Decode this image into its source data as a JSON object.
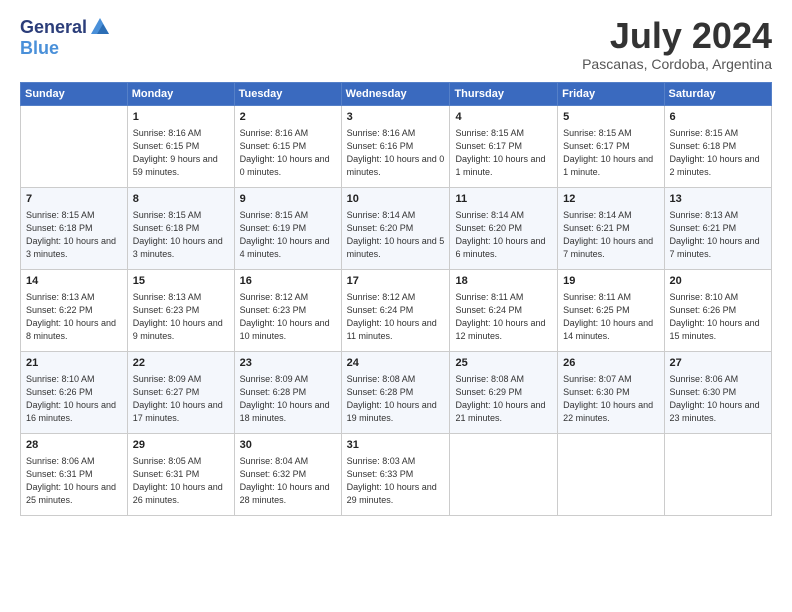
{
  "logo": {
    "general": "General",
    "blue": "Blue"
  },
  "title": "July 2024",
  "location": "Pascanas, Cordoba, Argentina",
  "weekdays": [
    "Sunday",
    "Monday",
    "Tuesday",
    "Wednesday",
    "Thursday",
    "Friday",
    "Saturday"
  ],
  "weeks": [
    [
      {
        "day": "",
        "sunrise": "",
        "sunset": "",
        "daylight": ""
      },
      {
        "day": "1",
        "sunrise": "Sunrise: 8:16 AM",
        "sunset": "Sunset: 6:15 PM",
        "daylight": "Daylight: 9 hours and 59 minutes."
      },
      {
        "day": "2",
        "sunrise": "Sunrise: 8:16 AM",
        "sunset": "Sunset: 6:15 PM",
        "daylight": "Daylight: 10 hours and 0 minutes."
      },
      {
        "day": "3",
        "sunrise": "Sunrise: 8:16 AM",
        "sunset": "Sunset: 6:16 PM",
        "daylight": "Daylight: 10 hours and 0 minutes."
      },
      {
        "day": "4",
        "sunrise": "Sunrise: 8:15 AM",
        "sunset": "Sunset: 6:17 PM",
        "daylight": "Daylight: 10 hours and 1 minute."
      },
      {
        "day": "5",
        "sunrise": "Sunrise: 8:15 AM",
        "sunset": "Sunset: 6:17 PM",
        "daylight": "Daylight: 10 hours and 1 minute."
      },
      {
        "day": "6",
        "sunrise": "Sunrise: 8:15 AM",
        "sunset": "Sunset: 6:18 PM",
        "daylight": "Daylight: 10 hours and 2 minutes."
      }
    ],
    [
      {
        "day": "7",
        "sunrise": "Sunrise: 8:15 AM",
        "sunset": "Sunset: 6:18 PM",
        "daylight": "Daylight: 10 hours and 3 minutes."
      },
      {
        "day": "8",
        "sunrise": "Sunrise: 8:15 AM",
        "sunset": "Sunset: 6:18 PM",
        "daylight": "Daylight: 10 hours and 3 minutes."
      },
      {
        "day": "9",
        "sunrise": "Sunrise: 8:15 AM",
        "sunset": "Sunset: 6:19 PM",
        "daylight": "Daylight: 10 hours and 4 minutes."
      },
      {
        "day": "10",
        "sunrise": "Sunrise: 8:14 AM",
        "sunset": "Sunset: 6:20 PM",
        "daylight": "Daylight: 10 hours and 5 minutes."
      },
      {
        "day": "11",
        "sunrise": "Sunrise: 8:14 AM",
        "sunset": "Sunset: 6:20 PM",
        "daylight": "Daylight: 10 hours and 6 minutes."
      },
      {
        "day": "12",
        "sunrise": "Sunrise: 8:14 AM",
        "sunset": "Sunset: 6:21 PM",
        "daylight": "Daylight: 10 hours and 7 minutes."
      },
      {
        "day": "13",
        "sunrise": "Sunrise: 8:13 AM",
        "sunset": "Sunset: 6:21 PM",
        "daylight": "Daylight: 10 hours and 7 minutes."
      }
    ],
    [
      {
        "day": "14",
        "sunrise": "Sunrise: 8:13 AM",
        "sunset": "Sunset: 6:22 PM",
        "daylight": "Daylight: 10 hours and 8 minutes."
      },
      {
        "day": "15",
        "sunrise": "Sunrise: 8:13 AM",
        "sunset": "Sunset: 6:23 PM",
        "daylight": "Daylight: 10 hours and 9 minutes."
      },
      {
        "day": "16",
        "sunrise": "Sunrise: 8:12 AM",
        "sunset": "Sunset: 6:23 PM",
        "daylight": "Daylight: 10 hours and 10 minutes."
      },
      {
        "day": "17",
        "sunrise": "Sunrise: 8:12 AM",
        "sunset": "Sunset: 6:24 PM",
        "daylight": "Daylight: 10 hours and 11 minutes."
      },
      {
        "day": "18",
        "sunrise": "Sunrise: 8:11 AM",
        "sunset": "Sunset: 6:24 PM",
        "daylight": "Daylight: 10 hours and 12 minutes."
      },
      {
        "day": "19",
        "sunrise": "Sunrise: 8:11 AM",
        "sunset": "Sunset: 6:25 PM",
        "daylight": "Daylight: 10 hours and 14 minutes."
      },
      {
        "day": "20",
        "sunrise": "Sunrise: 8:10 AM",
        "sunset": "Sunset: 6:26 PM",
        "daylight": "Daylight: 10 hours and 15 minutes."
      }
    ],
    [
      {
        "day": "21",
        "sunrise": "Sunrise: 8:10 AM",
        "sunset": "Sunset: 6:26 PM",
        "daylight": "Daylight: 10 hours and 16 minutes."
      },
      {
        "day": "22",
        "sunrise": "Sunrise: 8:09 AM",
        "sunset": "Sunset: 6:27 PM",
        "daylight": "Daylight: 10 hours and 17 minutes."
      },
      {
        "day": "23",
        "sunrise": "Sunrise: 8:09 AM",
        "sunset": "Sunset: 6:28 PM",
        "daylight": "Daylight: 10 hours and 18 minutes."
      },
      {
        "day": "24",
        "sunrise": "Sunrise: 8:08 AM",
        "sunset": "Sunset: 6:28 PM",
        "daylight": "Daylight: 10 hours and 19 minutes."
      },
      {
        "day": "25",
        "sunrise": "Sunrise: 8:08 AM",
        "sunset": "Sunset: 6:29 PM",
        "daylight": "Daylight: 10 hours and 21 minutes."
      },
      {
        "day": "26",
        "sunrise": "Sunrise: 8:07 AM",
        "sunset": "Sunset: 6:30 PM",
        "daylight": "Daylight: 10 hours and 22 minutes."
      },
      {
        "day": "27",
        "sunrise": "Sunrise: 8:06 AM",
        "sunset": "Sunset: 6:30 PM",
        "daylight": "Daylight: 10 hours and 23 minutes."
      }
    ],
    [
      {
        "day": "28",
        "sunrise": "Sunrise: 8:06 AM",
        "sunset": "Sunset: 6:31 PM",
        "daylight": "Daylight: 10 hours and 25 minutes."
      },
      {
        "day": "29",
        "sunrise": "Sunrise: 8:05 AM",
        "sunset": "Sunset: 6:31 PM",
        "daylight": "Daylight: 10 hours and 26 minutes."
      },
      {
        "day": "30",
        "sunrise": "Sunrise: 8:04 AM",
        "sunset": "Sunset: 6:32 PM",
        "daylight": "Daylight: 10 hours and 28 minutes."
      },
      {
        "day": "31",
        "sunrise": "Sunrise: 8:03 AM",
        "sunset": "Sunset: 6:33 PM",
        "daylight": "Daylight: 10 hours and 29 minutes."
      },
      {
        "day": "",
        "sunrise": "",
        "sunset": "",
        "daylight": ""
      },
      {
        "day": "",
        "sunrise": "",
        "sunset": "",
        "daylight": ""
      },
      {
        "day": "",
        "sunrise": "",
        "sunset": "",
        "daylight": ""
      }
    ]
  ]
}
